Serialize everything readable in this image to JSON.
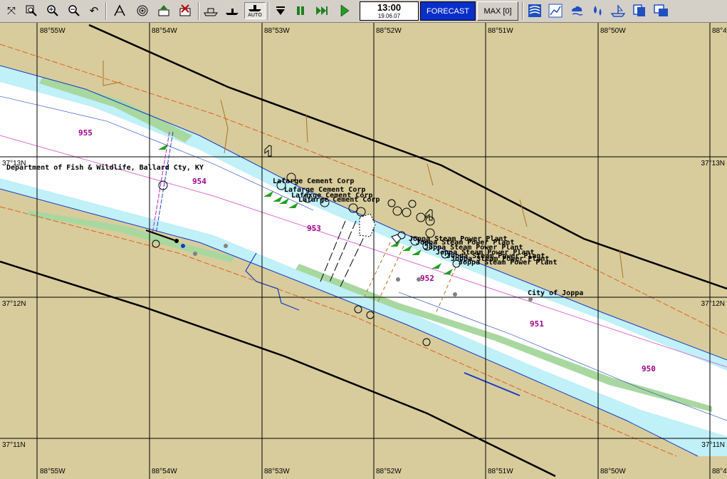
{
  "toolbar": {
    "time": "13:00",
    "date": "19.06.07",
    "forecast_label": "FORECAST",
    "max_label": "MAX [0]",
    "auto_label": "AUTO",
    "colors": {
      "forecast_bg": "#0a2ec8",
      "land": "#d8cc9c",
      "shallow": "#c0f0f8",
      "channel": "#ffffff"
    },
    "icons": [
      "fit-all-icon",
      "zoom-window-icon",
      "zoom-in-icon",
      "zoom-out-icon",
      "undo-icon",
      "route-icon",
      "target-icon",
      "export-icon",
      "delete-icon",
      "ship-icon",
      "own-ship-icon",
      "auto-icon",
      "stop-icon",
      "pause-icon",
      "fast-forward-icon",
      "play-icon",
      "layers-icon",
      "chart-icon",
      "weather-icon",
      "depth-icon",
      "ship-config-icon",
      "copy-icon",
      "window-icon"
    ]
  },
  "map": {
    "longitudes": [
      "88°55W",
      "88°54W",
      "88°53W",
      "88°52W",
      "88°51W",
      "88°50W",
      "88°4"
    ],
    "latitudes": [
      "37°13N",
      "37°12N",
      "37°11N"
    ],
    "river_miles": [
      "955",
      "954",
      "953",
      "952",
      "951",
      "950"
    ],
    "features": {
      "fish_wildlife": "Department of Fish & Wildlife, Ballard Cty, KY",
      "lafarge_1": "Lafarge Cement Corp",
      "lafarge_2": "Lafarge Cement Corp",
      "lafarge_3": "Lafarge Cement Corp",
      "lafarge_4": "Lafarge Cement Corp",
      "joppa_1": "Joppa Steam Power Plant",
      "joppa_2": "Joppa Steam Power Plant",
      "joppa_3": "Joppa Steam Power Plant",
      "joppa_4": "Joppa Steam Power Plant",
      "joppa_5": "Joppa Steam Power Plant",
      "joppa_6": "Joppa Steam Power Plant",
      "joppa_7": "Joppa Steam Power Plant",
      "city": "City of Joppa"
    }
  }
}
